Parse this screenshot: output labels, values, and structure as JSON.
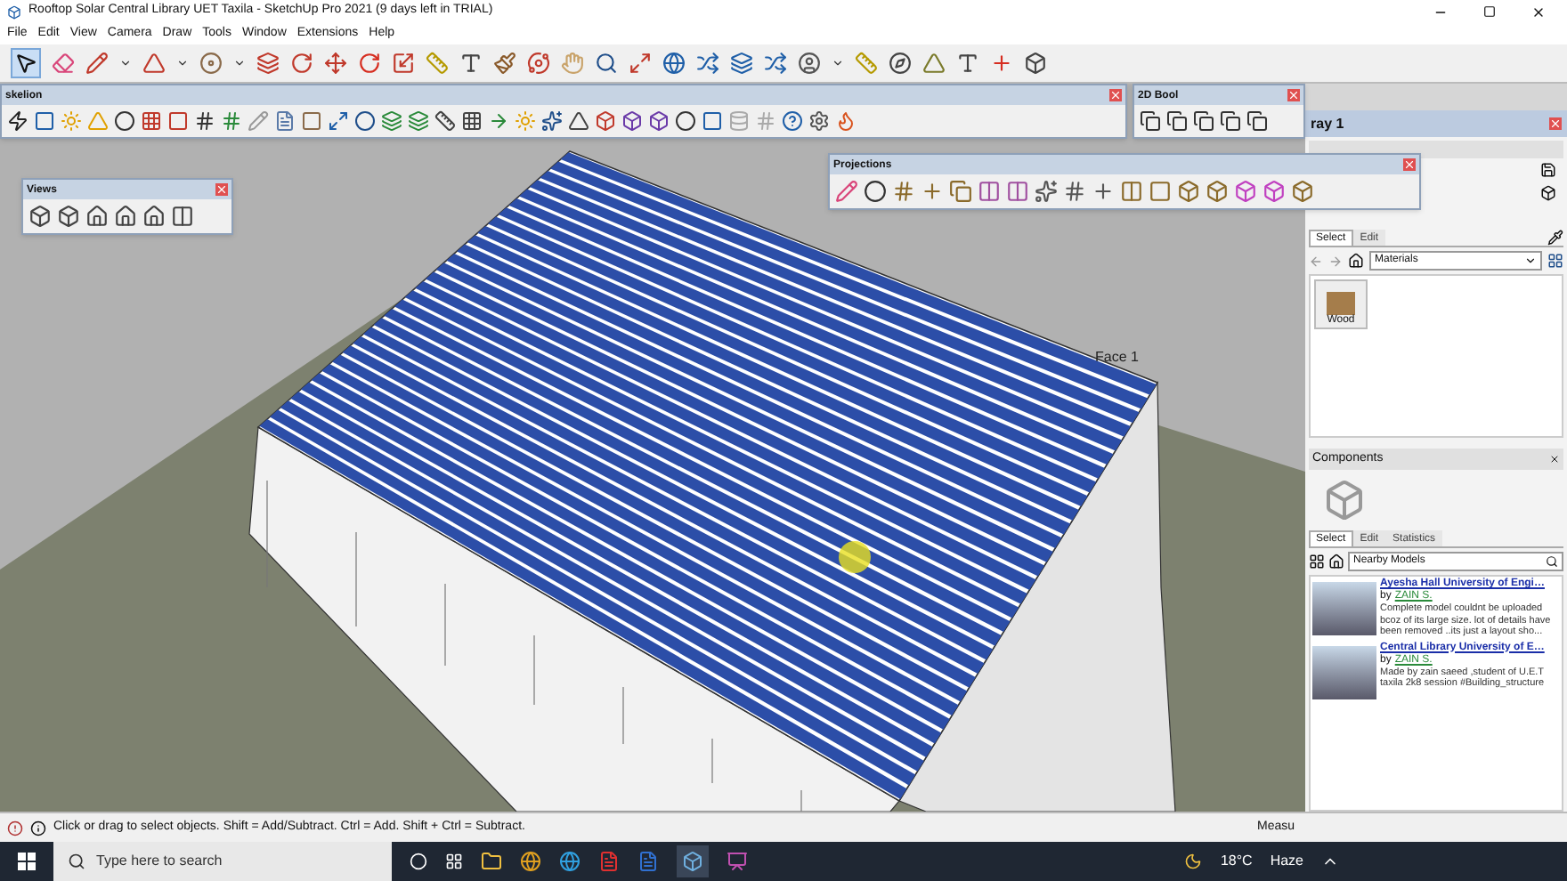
{
  "window": {
    "title": "Rooftop Solar Central Library UET Taxila - SketchUp Pro 2021 (9 days left in TRIAL)"
  },
  "menu": [
    "File",
    "Edit",
    "View",
    "Camera",
    "Draw",
    "Tools",
    "Window",
    "Extensions",
    "Help"
  ],
  "toolbars": [
    {
      "title": "skelion"
    },
    {
      "title": "2D Bool"
    },
    {
      "title": "Views"
    },
    {
      "title": "Projections"
    }
  ],
  "viewport": {
    "label": "Face 1"
  },
  "tray": {
    "title": "ray 1",
    "materials": {
      "tabs": [
        {
          "label": "Select",
          "selected": true
        },
        {
          "label": "Edit",
          "selected": false
        }
      ],
      "collection": "Materials",
      "swatches": [
        {
          "label": "Wood"
        }
      ]
    },
    "components": {
      "title": "Components",
      "tabs": [
        {
          "label": "Select",
          "selected": true
        },
        {
          "label": "Edit",
          "selected": false
        },
        {
          "label": "Statistics",
          "selected": false
        }
      ],
      "search": "Nearby Models",
      "results": [
        {
          "title": "Ayesha Hall University of Engi…",
          "by": "by",
          "author": "ZAIN S.",
          "description": "Complete model couldnt be uploaded bcoz of its large size. lot of details have been removed ..its just a layout sho..."
        },
        {
          "title": "Central Library University of E…",
          "by": "by",
          "author": "ZAIN S.",
          "description": "Made by zain saeed ,student of U.E.T taxila 2k8 session #Building_structure"
        }
      ]
    }
  },
  "status_bar": {
    "hint": "Click or drag to select objects. Shift = Add/Subtract. Ctrl = Add. Shift + Ctrl = Subtract.",
    "measurements": "Measu"
  },
  "taskbar": {
    "search_placeholder": "Type here to search",
    "temperature": "18°C",
    "weather": "Haze"
  }
}
